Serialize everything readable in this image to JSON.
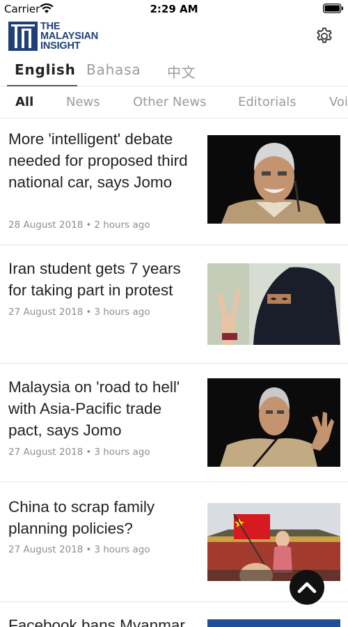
{
  "status_bar": {
    "carrier": "Carrier",
    "time": "2:29 AM"
  },
  "header": {
    "logo_lines": [
      "THE",
      "MALAYSIAN",
      "INSIGHT"
    ],
    "brand_color": "#1f3f77",
    "settings_icon": "gear-icon"
  },
  "language_tabs": [
    {
      "label": "English",
      "active": true
    },
    {
      "label": "Bahasa",
      "active": false
    },
    {
      "label": "中文",
      "active": false
    }
  ],
  "category_tabs": [
    {
      "label": "All",
      "active": true
    },
    {
      "label": "News",
      "active": false
    },
    {
      "label": "Other News",
      "active": false
    },
    {
      "label": "Editorials",
      "active": false
    },
    {
      "label": "Voi",
      "active": false
    }
  ],
  "articles": [
    {
      "headline": "More 'intelligent' debate needed for proposed third national car, says Jomo",
      "date": "28 August 2018",
      "ago": "2 hours ago"
    },
    {
      "headline": "Iran student gets 7 years for taking part in protest",
      "date": "27 August 2018",
      "ago": "3 hours ago"
    },
    {
      "headline": "Malaysia on 'road to hell' with Asia-Pacific trade pact, says Jomo",
      "date": "27 August 2018",
      "ago": "3 hours ago"
    },
    {
      "headline": "China to scrap family planning policies?",
      "date": "27 August 2018",
      "ago": "3 hours ago"
    },
    {
      "headline": "Facebook bans Myanmar"
    }
  ],
  "scroll_top_icon": "chevron-up-icon"
}
